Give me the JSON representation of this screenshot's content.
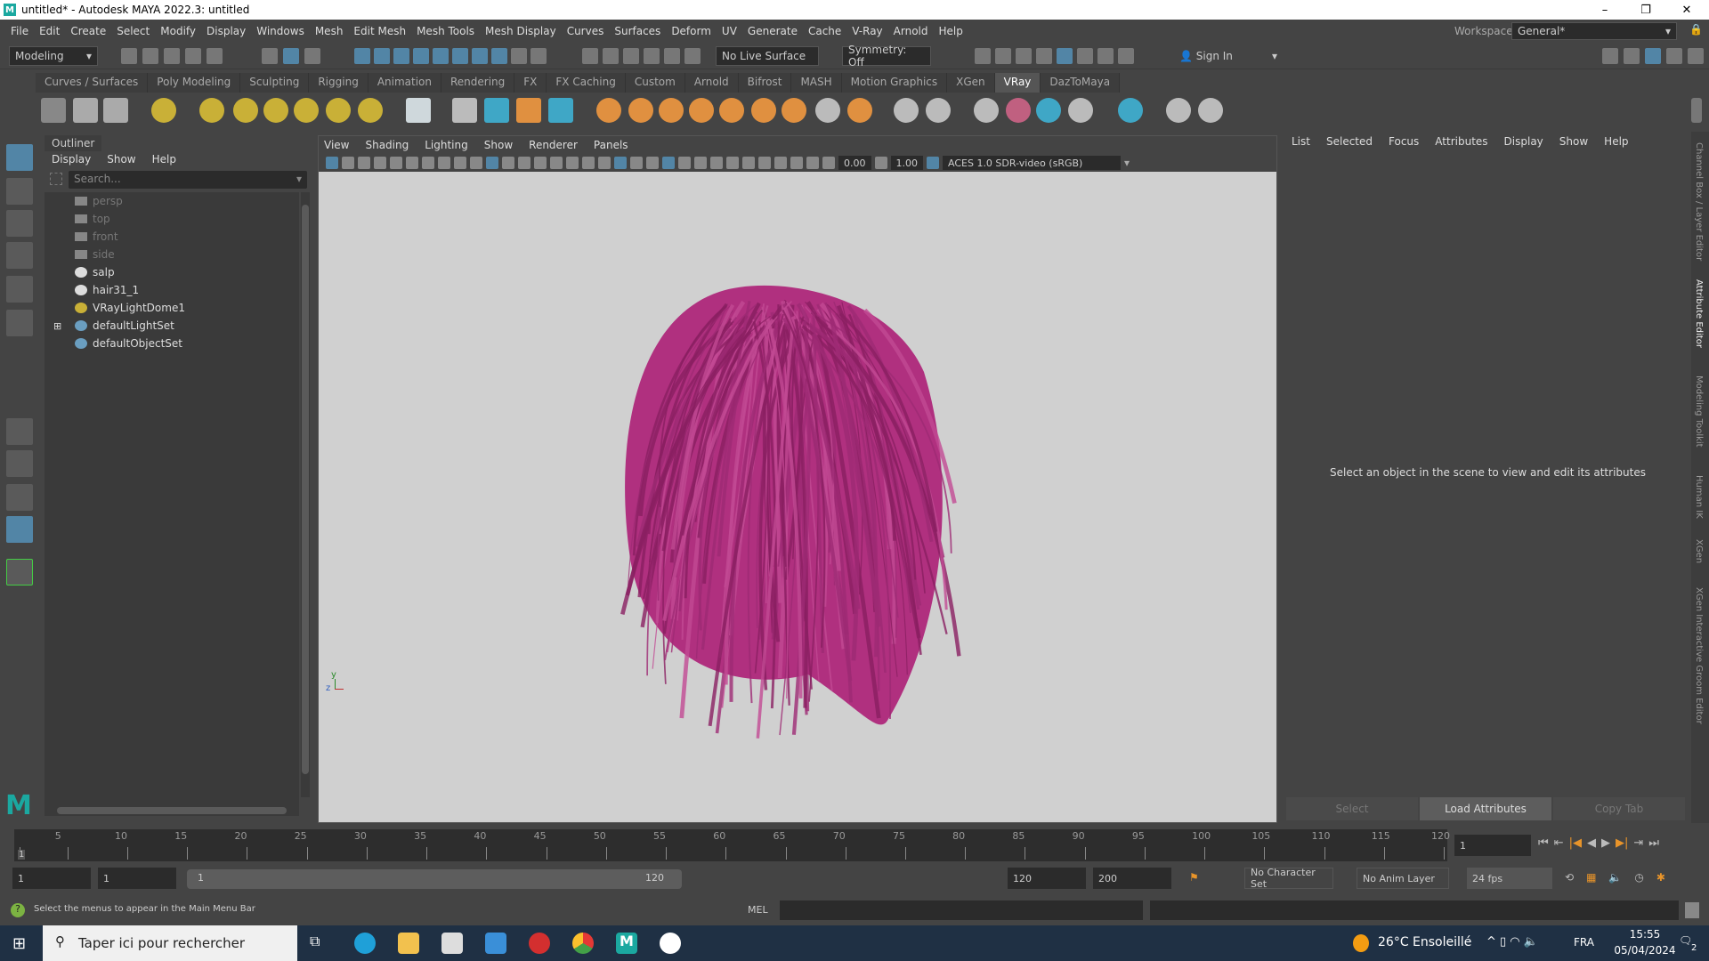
{
  "window": {
    "title": "untitled* - Autodesk MAYA 2022.3: untitled",
    "logo": "M",
    "minimize": "–",
    "maximize": "❐",
    "close": "✕"
  },
  "menubar": {
    "items": [
      "File",
      "Edit",
      "Create",
      "Select",
      "Modify",
      "Display",
      "Windows",
      "Mesh",
      "Edit Mesh",
      "Mesh Tools",
      "Mesh Display",
      "Curves",
      "Surfaces",
      "Deform",
      "UV",
      "Generate",
      "Cache",
      "V-Ray",
      "Arnold",
      "Help"
    ],
    "workspace_label": "Workspace:",
    "workspace_value": "General*"
  },
  "statusline": {
    "mode": "Modeling",
    "live_surface": "No Live Surface",
    "symmetry": "Symmetry: Off",
    "sign_in": "Sign In"
  },
  "shelf": {
    "tabs": [
      "Curves / Surfaces",
      "Poly Modeling",
      "Sculpting",
      "Rigging",
      "Animation",
      "Rendering",
      "FX",
      "FX Caching",
      "Custom",
      "Arnold",
      "Bifrost",
      "MASH",
      "Motion Graphics",
      "XGen",
      "VRay",
      "DazToMaya"
    ],
    "active": "VRay"
  },
  "outliner": {
    "title": "Outliner",
    "menu": [
      "Display",
      "Show",
      "Help"
    ],
    "search_placeholder": "Search...",
    "items": [
      {
        "label": "persp",
        "icon": "camera-icon",
        "dim": true
      },
      {
        "label": "top",
        "icon": "camera-icon",
        "dim": true
      },
      {
        "label": "front",
        "icon": "camera-icon",
        "dim": true
      },
      {
        "label": "side",
        "icon": "camera-icon",
        "dim": true
      },
      {
        "label": "salp",
        "icon": "transform-icon",
        "dim": false
      },
      {
        "label": "hair31_1",
        "icon": "transform-icon",
        "dim": false
      },
      {
        "label": "VRayLightDome1",
        "icon": "dome-light-icon",
        "dim": false
      },
      {
        "label": "defaultLightSet",
        "icon": "set-icon",
        "dim": false,
        "expandable": "⊞"
      },
      {
        "label": "defaultObjectSet",
        "icon": "set-icon",
        "dim": false
      }
    ]
  },
  "viewport": {
    "menu": [
      "View",
      "Shading",
      "Lighting",
      "Show",
      "Renderer",
      "Panels"
    ],
    "exposure": "0.00",
    "gamma": "1.00",
    "color_space": "ACES 1.0 SDR-video (sRGB)",
    "hair_color": "#b0307f",
    "axis_y": "y",
    "axis_z": "z"
  },
  "attribute_editor": {
    "menu": [
      "List",
      "Selected",
      "Focus",
      "Attributes",
      "Display",
      "Show",
      "Help"
    ],
    "message": "Select an object in the scene to view and edit its attributes",
    "buttons": [
      "Select",
      "Load Attributes",
      "Copy Tab"
    ]
  },
  "side_tabs": [
    "Channel Box / Layer Editor",
    "Attribute Editor",
    "Modeling Toolkit",
    "Human IK",
    "XGen",
    "XGen Interactive Groom Editor"
  ],
  "timeline": {
    "ticks": [
      "5",
      "10",
      "15",
      "20",
      "25",
      "30",
      "35",
      "40",
      "45",
      "50",
      "55",
      "60",
      "65",
      "70",
      "75",
      "80",
      "85",
      "90",
      "95",
      "100",
      "105",
      "110",
      "115",
      "120"
    ],
    "current_marker": "1",
    "current_frame": "1"
  },
  "range": {
    "start": "1",
    "anim_start": "1",
    "slider_start": "1",
    "slider_end": "120",
    "end": "120",
    "anim_end": "200",
    "character_set": "No Character Set",
    "anim_layer": "No Anim Layer",
    "fps": "24 fps"
  },
  "command": {
    "help_text": "Select the menus to appear in the Main Menu Bar",
    "lang": "MEL"
  },
  "taskbar": {
    "search": "Taper ici pour rechercher",
    "weather": "26°C  Ensoleillé",
    "lang": "FRA",
    "time": "15:55",
    "date": "05/04/2024",
    "notifications": "2"
  }
}
